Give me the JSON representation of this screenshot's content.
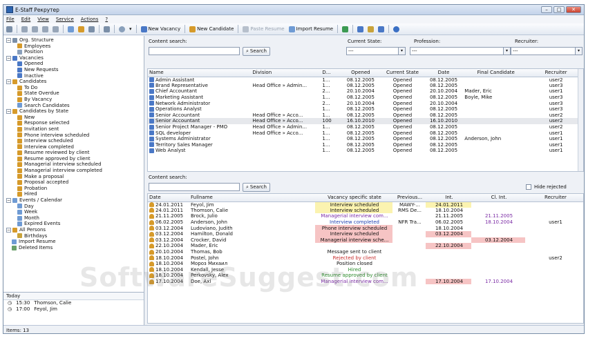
{
  "window": {
    "title": "E-Staff Рекрутер"
  },
  "menu": [
    "File",
    "Edit",
    "View",
    "Service",
    "Actions",
    "?"
  ],
  "toolbar": {
    "new_vacancy": "New Vacancy",
    "new_candidate": "New Candidate",
    "paste_resume": "Paste Resume",
    "import_resume": "Import Resume"
  },
  "tree": [
    {
      "label": "Org. Structure",
      "level": 0,
      "exp": "−",
      "icon": "org-icon"
    },
    {
      "label": "Employees",
      "level": 2,
      "icon": "person-icon"
    },
    {
      "label": "Position",
      "level": 2,
      "icon": "position-icon"
    },
    {
      "label": "Vacancies",
      "level": 0,
      "exp": "−",
      "icon": "vacancy-icon"
    },
    {
      "label": "Opened",
      "level": 2,
      "icon": "vacancy-icon"
    },
    {
      "label": "New Requests",
      "level": 2,
      "icon": "vacancy-icon"
    },
    {
      "label": "Inactive",
      "level": 2,
      "icon": "vacancy-icon"
    },
    {
      "label": "Candidates",
      "level": 0,
      "exp": "−",
      "icon": "person-icon"
    },
    {
      "label": "To Do",
      "level": 2,
      "icon": "person-icon"
    },
    {
      "label": "State Overdue",
      "level": 2,
      "icon": "person-icon"
    },
    {
      "label": "By Vacancy",
      "level": 2,
      "icon": "person-icon"
    },
    {
      "label": "Search Candidates",
      "level": 2,
      "icon": "search-icon"
    },
    {
      "label": "Candidates by State",
      "level": 0,
      "exp": "−",
      "icon": "person-icon"
    },
    {
      "label": "New",
      "level": 2,
      "icon": "person-icon"
    },
    {
      "label": "Response selected",
      "level": 2,
      "icon": "person-icon"
    },
    {
      "label": "Invitation sent",
      "level": 2,
      "icon": "person-icon"
    },
    {
      "label": "Phone interview scheduled",
      "level": 2,
      "icon": "person-icon"
    },
    {
      "label": "Interview scheduled",
      "level": 2,
      "icon": "person-icon"
    },
    {
      "label": "Interview completed",
      "level": 2,
      "icon": "person-icon"
    },
    {
      "label": "Resume reviewed by client",
      "level": 2,
      "icon": "person-icon"
    },
    {
      "label": "Resume approved by client",
      "level": 2,
      "icon": "person-icon"
    },
    {
      "label": "Managerial interview scheduled",
      "level": 2,
      "icon": "person-icon"
    },
    {
      "label": "Managerial interview completed",
      "level": 2,
      "icon": "person-icon"
    },
    {
      "label": "Make a proposal",
      "level": 2,
      "icon": "person-icon"
    },
    {
      "label": "Proposal accepted",
      "level": 2,
      "icon": "person-icon"
    },
    {
      "label": "Probation",
      "level": 2,
      "icon": "person-icon"
    },
    {
      "label": "Hired",
      "level": 2,
      "icon": "person-icon"
    },
    {
      "label": "Events / Calendar",
      "level": 0,
      "exp": "−",
      "icon": "calendar-icon"
    },
    {
      "label": "Day",
      "level": 2,
      "icon": "calendar-icon"
    },
    {
      "label": "Week",
      "level": 2,
      "icon": "calendar-icon"
    },
    {
      "label": "Month",
      "level": 2,
      "icon": "calendar-icon"
    },
    {
      "label": "Expired Events",
      "level": 2,
      "icon": "calendar-icon"
    },
    {
      "label": "All Persons",
      "level": 0,
      "exp": "−",
      "icon": "person-icon"
    },
    {
      "label": "Birthdays",
      "level": 2,
      "icon": "birthday-icon"
    },
    {
      "label": "Import Resume",
      "level": 1,
      "icon": "import-icon"
    },
    {
      "label": "Deleted Items",
      "level": 1,
      "icon": "trash-icon"
    }
  ],
  "today": {
    "title": "Today",
    "items": [
      {
        "time": "15:30",
        "name": "Thomson, Calie"
      },
      {
        "time": "17:00",
        "name": "Feyol, Jim"
      }
    ]
  },
  "status": "Items: 13",
  "vacancy_search": {
    "content_label": "Content search:",
    "search_button": "Search",
    "state_label": "Current State:",
    "state_value": "---",
    "profession_label": "Profession:",
    "profession_value": "---",
    "recruiter_label": "Recruiter:",
    "recruiter_value": "---"
  },
  "vacancy_table": {
    "columns": [
      "Name",
      "Division",
      "D...",
      "Opened",
      "Current State",
      "Date",
      "Final Candidate",
      "Recruiter"
    ],
    "rows": [
      [
        "Admin Assistant",
        "",
        "1...",
        "08.12.2005",
        "Opened",
        "08.12.2005",
        "",
        "user2"
      ],
      [
        "Brand Representative",
        "Head Office » Admin...",
        "1...",
        "08.12.2005",
        "Opened",
        "08.12.2005",
        "",
        "user3"
      ],
      [
        "Chief Accountant",
        "",
        "2...",
        "20.10.2004",
        "Opened",
        "20.10.2004",
        "Mader, Eric",
        "user1"
      ],
      [
        "Marketing Assistant",
        "",
        "1...",
        "08.12.2005",
        "Opened",
        "08.12.2005",
        "Boyle, Mike",
        "user3"
      ],
      [
        "Network Administrator",
        "",
        "2...",
        "20.10.2004",
        "Opened",
        "20.10.2004",
        "",
        "user3"
      ],
      [
        "Operations Analyst",
        "",
        "1...",
        "08.12.2005",
        "Opened",
        "08.12.2005",
        "",
        "user3"
      ],
      [
        "Senior Accountant",
        "Head Office » Acco...",
        "1...",
        "08.12.2005",
        "Opened",
        "08.12.2005",
        "",
        "user2"
      ],
      [
        "Senior Accountant",
        "Head Office » Acco...",
        "100",
        "16.10.2010",
        "Opened",
        "16.10.2010",
        "",
        "user2"
      ],
      [
        "Senior Project Manager - PMO",
        "Head Office » Admin...",
        "1...",
        "08.12.2005",
        "Opened",
        "08.12.2005",
        "",
        "user2"
      ],
      [
        "SQL developer",
        "Head Office » Acco...",
        "1...",
        "08.12.2005",
        "Opened",
        "08.12.2005",
        "",
        "user1"
      ],
      [
        "Systems Administrator",
        "",
        "1...",
        "08.12.2005",
        "Opened",
        "08.12.2005",
        "Anderson, John",
        "user1"
      ],
      [
        "Territory Sales Manager",
        "",
        "1...",
        "08.12.2005",
        "Opened",
        "08.12.2005",
        "",
        "user1"
      ],
      [
        "Web Analyst",
        "",
        "1...",
        "08.12.2005",
        "Opened",
        "08.12.2005",
        "",
        "user1"
      ]
    ]
  },
  "candidate_search": {
    "content_label": "Content search:",
    "search_button": "Search",
    "hide_rejected": "Hide rejected"
  },
  "candidate_table": {
    "columns": [
      "Date",
      "Fullname",
      "Vacancy specific state",
      "Previous...",
      "Int.",
      "Cl. Int.",
      "Recruiter"
    ],
    "rows": [
      {
        "date": "24.01.2011",
        "name": "Feyol, Jim",
        "state": "Interview scheduled",
        "state_style": "yellow",
        "prev": "MAWY-...",
        "int": "24.01.2011",
        "int_style": "yellow",
        "clint": "",
        "clint_style": "",
        "rec": ""
      },
      {
        "date": "24.01.2011",
        "name": "Thomson, Calie",
        "state": "Interview scheduled",
        "state_style": "yellow",
        "prev": "RMS De...",
        "int": "18.10.2004",
        "int_style": "",
        "clint": "",
        "clint_style": "",
        "rec": ""
      },
      {
        "date": "21.11.2005",
        "name": "Brock, Julio",
        "state": "Managerial interview com...",
        "state_style": "purple",
        "prev": "",
        "int": "21.11.2005",
        "int_style": "",
        "clint": "21.11.2005",
        "clint_style": "purple",
        "rec": ""
      },
      {
        "date": "06.02.2005",
        "name": "Anderson, John",
        "state": "Interview completed",
        "state_style": "blue",
        "prev": "NFR Tra...",
        "int": "06.02.2005",
        "int_style": "",
        "clint": "18.10.2004",
        "clint_style": "purple",
        "rec": "user1"
      },
      {
        "date": "03.12.2004",
        "name": "Ludoviano, Judith",
        "state": "Phone interview scheduled",
        "state_style": "pink",
        "prev": "",
        "int": "18.10.2004",
        "int_style": "",
        "clint": "",
        "clint_style": "",
        "rec": ""
      },
      {
        "date": "03.12.2004",
        "name": "Hamilton, Donald",
        "state": "Interview scheduled",
        "state_style": "pink",
        "prev": "",
        "int": "03.12.2004",
        "int_style": "pink",
        "clint": "",
        "clint_style": "",
        "rec": ""
      },
      {
        "date": "03.12.2004",
        "name": "Crocker, David",
        "state": "Managerial interview sche...",
        "state_style": "pink",
        "prev": "",
        "int": "",
        "int_style": "",
        "clint": "03.12.2004",
        "clint_style": "pink",
        "rec": ""
      },
      {
        "date": "22.10.2004",
        "name": "Mader, Eric",
        "state": "",
        "state_style": "",
        "prev": "",
        "int": "22.10.2004",
        "int_style": "pink",
        "clint": "",
        "clint_style": "",
        "rec": ""
      },
      {
        "date": "20.10.2004",
        "name": "Thomas, Bob",
        "state": "Message sent to client",
        "state_style": "",
        "prev": "",
        "int": "",
        "int_style": "",
        "clint": "",
        "clint_style": "",
        "rec": ""
      },
      {
        "date": "18.10.2004",
        "name": "Postel, John",
        "state": "Rejected by client",
        "state_style": "red",
        "prev": "",
        "int": "",
        "int_style": "",
        "clint": "",
        "clint_style": "",
        "rec": "user2"
      },
      {
        "date": "18.10.2004",
        "name": "Мороз Михаил",
        "state": "Position closed",
        "state_style": "",
        "prev": "",
        "int": "",
        "int_style": "",
        "clint": "",
        "clint_style": "",
        "rec": ""
      },
      {
        "date": "18.10.2004",
        "name": "Kendall, Jesse",
        "state": "Hired",
        "state_style": "green",
        "prev": "",
        "int": "",
        "int_style": "",
        "clint": "",
        "clint_style": "",
        "rec": ""
      },
      {
        "date": "18.10.2004",
        "name": "Perkovsky, Alex",
        "state": "Resume approved by client",
        "state_style": "green",
        "prev": "",
        "int": "",
        "int_style": "",
        "clint": "",
        "clint_style": "",
        "rec": ""
      },
      {
        "date": "17.10.2004",
        "name": "Doe, Axl",
        "state": "Managerial interview com...",
        "state_style": "purple",
        "prev": "",
        "int": "17.10.2004",
        "int_style": "pink",
        "clint": "17.10.2004",
        "clint_style": "purple",
        "rec": ""
      }
    ]
  },
  "watermark": "SoftwareSuggest.com"
}
